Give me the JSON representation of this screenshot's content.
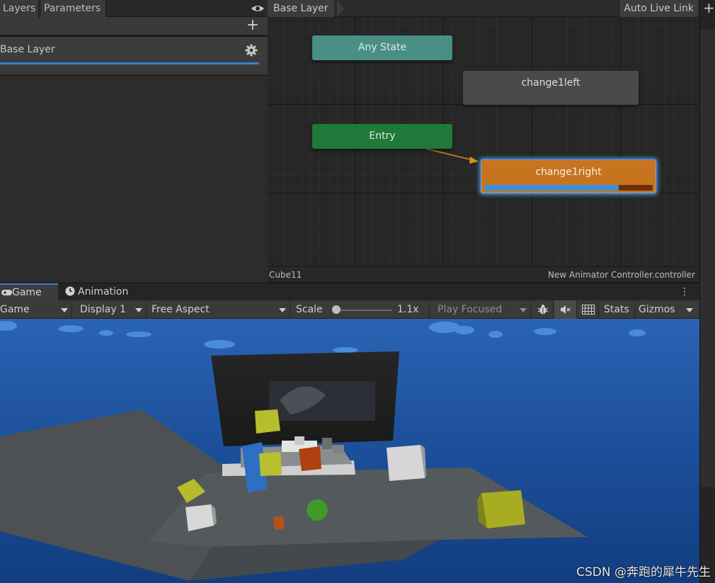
{
  "animator": {
    "left_tabs": [
      "Layers",
      "Parameters"
    ],
    "breadcrumb": "Base Layer",
    "auto_live_link": "Auto Live Link",
    "layer": {
      "name": "Base Layer"
    },
    "states": {
      "any_state": "Any State",
      "change_left": "change1left",
      "entry": "Entry",
      "change_right": "change1right"
    },
    "active_state_progress": 0.8,
    "footer_left": "Cube11",
    "footer_right": "New Animator Controller.controller"
  },
  "game": {
    "tabs": [
      "Game",
      "Animation"
    ],
    "toolbar": {
      "view_mode": "Game",
      "display": "Display 1",
      "aspect": "Free Aspect",
      "scale_label": "Scale",
      "scale_value": "1.1x",
      "play_mode": "Play Focused",
      "stats": "Stats",
      "gizmos": "Gizmos"
    }
  },
  "watermark": "CSDN @奔跑的犀牛先生",
  "colors": {
    "accent": "#3a80cc",
    "any_state": "#4a8f84",
    "entry": "#1f7a3a",
    "active_state": "#c8741e",
    "sky": "#1d4f99"
  },
  "icons": [
    "eye-icon",
    "plus-icon",
    "gear-icon",
    "gamepad-icon",
    "clock-icon",
    "kebab-icon",
    "bug-icon",
    "mute-icon",
    "grid-icon"
  ]
}
